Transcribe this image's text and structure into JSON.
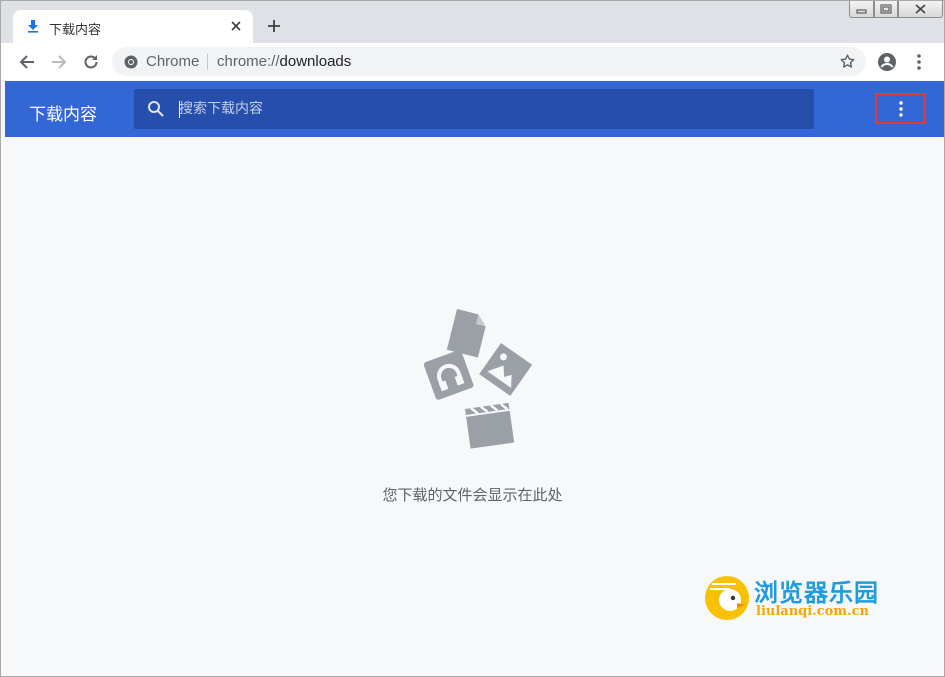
{
  "tab": {
    "title": "下载内容",
    "icon": "download-icon",
    "close_icon": "close-icon"
  },
  "new_tab_icon": "plus-icon",
  "window_controls": [
    "minimize",
    "restore",
    "close"
  ],
  "toolbar": {
    "back_icon": "arrow-left-icon",
    "forward_icon": "arrow-right-icon",
    "reload_icon": "reload-icon",
    "omnibox": {
      "site_label": "Chrome",
      "url_scheme": "chrome://",
      "url_host": "downloads",
      "bookmark_icon": "star-icon"
    },
    "profile_icon": "account-circle-icon",
    "menu_icon": "vertical-dots-icon"
  },
  "downloads": {
    "title": "下载内容",
    "search_placeholder": "搜索下载内容",
    "search_value": "",
    "more_icon": "vertical-dots-icon",
    "empty_message": "您下载的文件会显示在此处"
  },
  "watermark": {
    "name": "浏览器乐园",
    "url": "liulanqi.com.cn"
  },
  "colors": {
    "header_blue": "#3367d6",
    "search_blue": "#264fad",
    "highlight_red": "#e0393e",
    "page_bg": "#f7f8fa",
    "tabstrip": "#dee1e6"
  }
}
